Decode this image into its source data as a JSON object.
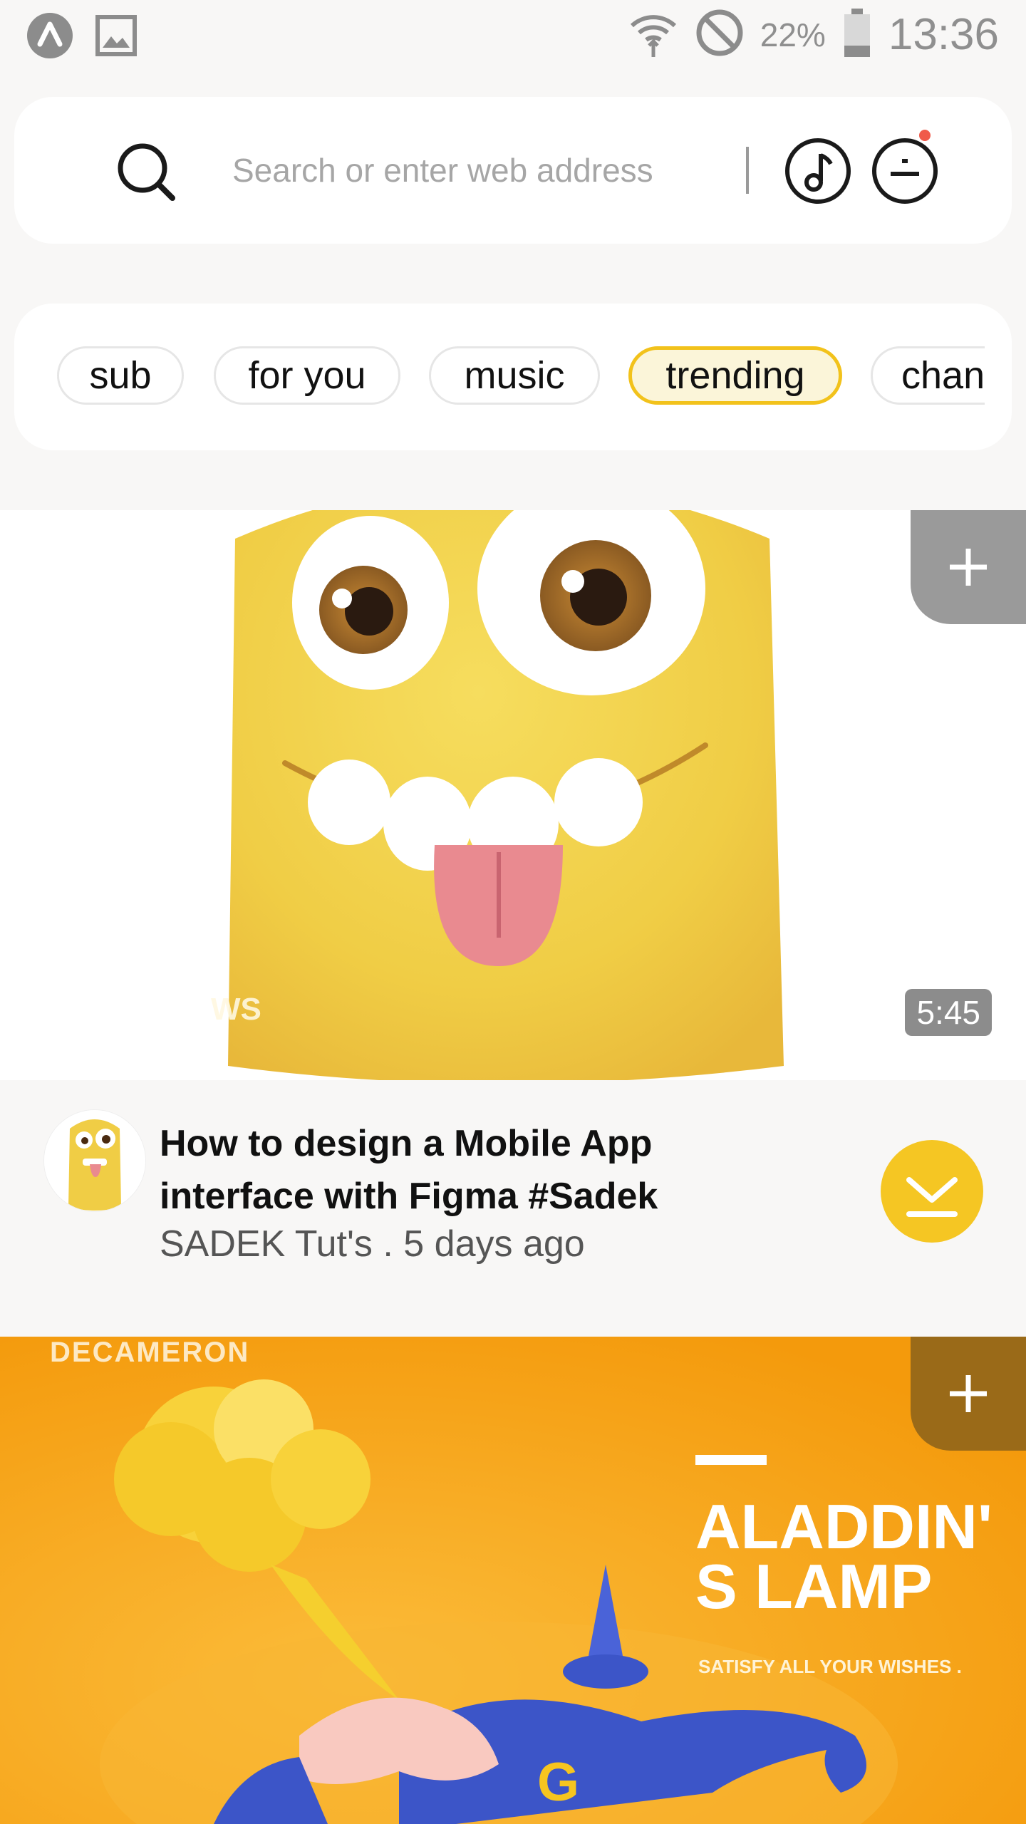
{
  "status_bar": {
    "battery_percent": "22%",
    "time": "13:36"
  },
  "search": {
    "placeholder": "Search or enter web address"
  },
  "chips": [
    {
      "label": "sub"
    },
    {
      "label": "for you"
    },
    {
      "label": "music"
    },
    {
      "label": "trending"
    },
    {
      "label": "chan"
    }
  ],
  "active_chip": "trending",
  "accent_color": "#f2c21b",
  "videos": [
    {
      "duration": "5:45",
      "thumbnail_text": "WS",
      "title": "How to design a Mobile App interface with Figma #Sadek",
      "channel": "SADEK Tut's",
      "separator": ".",
      "age": "5 days ago"
    },
    {
      "thumbnail_small_top": "DECAMERON",
      "thumbnail_title": "ALADDIN'S LAMP",
      "thumbnail_title_line1": "ALADDIN'",
      "thumbnail_title_line2": "S LAMP",
      "thumbnail_tagline": "SATISFY ALL YOUR WISHES .",
      "lamp_letter": "G"
    }
  ]
}
